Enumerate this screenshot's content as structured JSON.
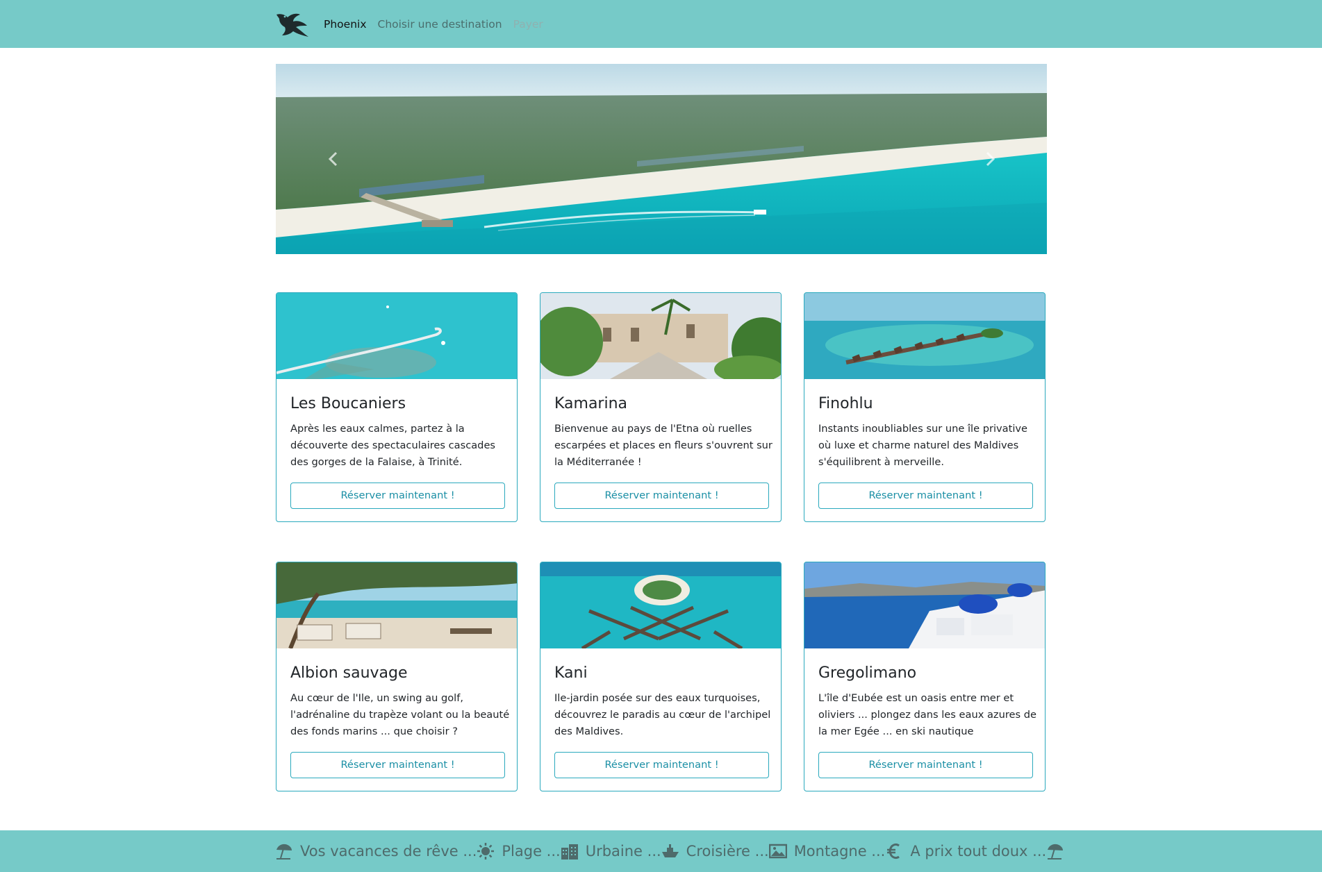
{
  "navbar": {
    "brand_icon": "phoenix-logo-icon",
    "links": [
      {
        "label": "Phoenix",
        "state": "active"
      },
      {
        "label": "Choisir une destination",
        "state": "normal"
      },
      {
        "label": "Payer",
        "state": "disabled"
      }
    ],
    "background": "#76cac8"
  },
  "carousel": {
    "prev_icon": "chevron-left-icon",
    "next_icon": "chevron-right-icon"
  },
  "cards": [
    {
      "title": "Les Boucaniers",
      "text": "Après les eaux calmes, partez à la découverte des spectaculaires cascades des gorges de la Falaise, à Trinité.",
      "button": "Réserver maintenant !"
    },
    {
      "title": "Kamarina",
      "text": "Bienvenue au pays de l'Etna où ruelles escarpées et places en fleurs s'ouvrent sur la Méditerranée !",
      "button": "Réserver maintenant !"
    },
    {
      "title": "Finohlu",
      "text": "Instants inoubliables sur une île privative où luxe et charme naturel des Maldives s'équilibrent à merveille.",
      "button": "Réserver maintenant !"
    },
    {
      "title": "Albion sauvage",
      "text": "Au cœur de l'Ile, un swing au golf, l'adrénaline du trapèze volant ou la beauté des fonds marins ... que choisir ?",
      "button": "Réserver maintenant !"
    },
    {
      "title": "Kani",
      "text": "Ile-jardin posée sur des eaux turquoises, découvrez le paradis au cœur de l'archipel des Maldives.",
      "button": "Réserver maintenant !"
    },
    {
      "title": "Gregolimano",
      "text": "L'île d'Eubée est un oasis entre mer et oliviers ... plongez dans les eaux azures de la mer Egée ... en ski nautique",
      "button": "Réserver maintenant !"
    }
  ],
  "footer": {
    "items": [
      {
        "label": "Vos vacances de rêve ...",
        "icon": "beach-umbrella-icon"
      },
      {
        "label": "Plage ...",
        "icon": "sun-icon"
      },
      {
        "label": "Urbaine ...",
        "icon": "city-icon"
      },
      {
        "label": "Croisière ...",
        "icon": "ship-icon"
      },
      {
        "label": "Montagne ...",
        "icon": "picture-icon"
      },
      {
        "label": "A prix tout doux ...",
        "icon": "euro-icon"
      }
    ],
    "end_icon": "beach-umbrella-icon",
    "background": "#76cac8"
  },
  "colors": {
    "accent": "#2aa9bd",
    "button_text": "#1b8fa5",
    "teal": "#76cac8"
  }
}
